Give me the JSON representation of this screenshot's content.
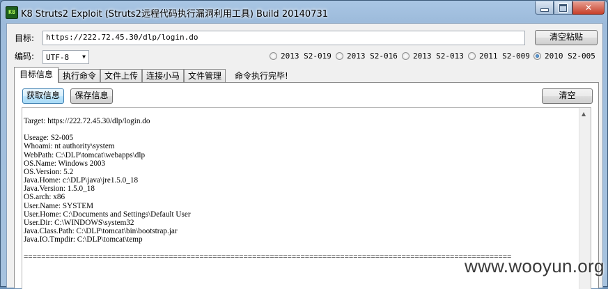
{
  "window": {
    "title": "K8 Struts2 Exploit (Struts2远程代码执行漏洞利用工具) Build 20140731",
    "icon_text": "K8",
    "controls": {
      "minimize": "minimize-icon",
      "maximize": "maximize-icon",
      "close": "close-icon"
    }
  },
  "target": {
    "label": "目标:",
    "url": "https://222.72.45.30/dlp/login.do",
    "clear_paste_label": "清空粘贴"
  },
  "encoding": {
    "label": "编码:",
    "selected": "UTF-8"
  },
  "exploits": [
    {
      "label": "2013 S2-019",
      "checked": false
    },
    {
      "label": "2013 S2-016",
      "checked": false
    },
    {
      "label": "2013 S2-013",
      "checked": false
    },
    {
      "label": "2011 S2-009",
      "checked": false
    },
    {
      "label": "2010 S2-005",
      "checked": true
    }
  ],
  "tabs": [
    {
      "label": "目标信息",
      "active": true
    },
    {
      "label": "执行命令",
      "active": false
    },
    {
      "label": "文件上传",
      "active": false
    },
    {
      "label": "连接小马",
      "active": false
    },
    {
      "label": "文件管理",
      "active": false
    }
  ],
  "status": "命令执行完毕!",
  "toolbar": {
    "get_info_label": "获取信息",
    "save_info_label": "保存信息",
    "clear_label": "清空"
  },
  "output": {
    "lines": [
      "Target: https://222.72.45.30/dlp/login.do",
      "",
      "Useage: S2-005",
      "Whoami: nt authority\\system",
      "WebPath: C:\\DLP\\tomcat\\webapps\\dlp",
      "OS.Name: Windows 2003",
      "OS.Version: 5.2",
      "Java.Home: c:\\DLP\\java\\jre1.5.0_18",
      "Java.Version: 1.5.0_18",
      "OS.arch: x86",
      "User.Name: SYSTEM",
      "User.Home: C:\\Documents and Settings\\Default User",
      "User.Dir: C:\\WINDOWS\\system32",
      "Java.Class.Path: C:\\DLP\\tomcat\\bin\\bootstrap.jar",
      "Java.IO.Tmpdir: C:\\DLP\\tomcat\\temp",
      "",
      "==============================================================================================================="
    ]
  },
  "watermark": "www.wooyun.org"
}
